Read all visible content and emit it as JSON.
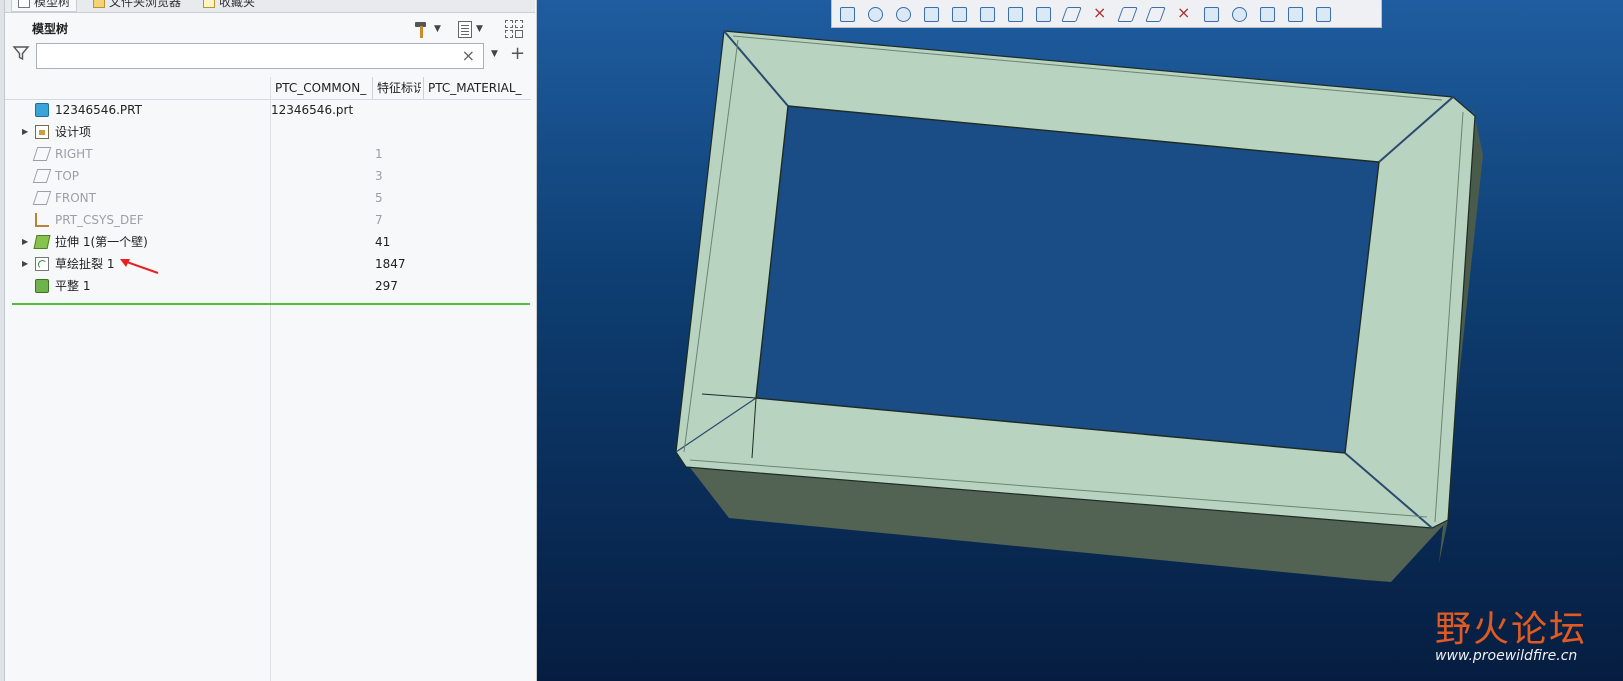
{
  "tabs": [
    {
      "label": "模型树",
      "active": true
    },
    {
      "label": "文件夹浏览器",
      "active": false
    },
    {
      "label": "收藏夹",
      "active": false
    }
  ],
  "panel_title": "模型树",
  "search": {
    "value": "",
    "clear_label": "×"
  },
  "columns": [
    "PTC_COMMON_",
    "特征标识",
    "PTC_MATERIAL_"
  ],
  "tree": [
    {
      "name": "12346546.PRT",
      "common": "12346546.prt",
      "id": "",
      "icon": "part-icon",
      "expandable": false,
      "faded": false
    },
    {
      "name": "设计项",
      "common": "",
      "id": "",
      "icon": "design-items-icon",
      "expandable": true,
      "faded": false
    },
    {
      "name": "RIGHT",
      "common": "",
      "id": "1",
      "icon": "datum-plane-icon",
      "expandable": false,
      "faded": true
    },
    {
      "name": "TOP",
      "common": "",
      "id": "3",
      "icon": "datum-plane-icon",
      "expandable": false,
      "faded": true
    },
    {
      "name": "FRONT",
      "common": "",
      "id": "5",
      "icon": "datum-plane-icon",
      "expandable": false,
      "faded": true
    },
    {
      "name": "PRT_CSYS_DEF",
      "common": "",
      "id": "7",
      "icon": "csys-icon",
      "expandable": false,
      "faded": true
    },
    {
      "name": "拉伸 1(第一个壁)",
      "common": "",
      "id": "41",
      "icon": "extrude-icon",
      "expandable": true,
      "faded": false
    },
    {
      "name": "草绘扯裂 1",
      "common": "",
      "id": "1847",
      "icon": "sketched-rip-icon",
      "expandable": true,
      "faded": false
    },
    {
      "name": "平整 1",
      "common": "",
      "id": "297",
      "icon": "flat-wall-icon",
      "expandable": false,
      "faded": false
    }
  ],
  "watermark": {
    "text_cn": "野火论坛",
    "url": "www.proewildfire.cn"
  },
  "colors": {
    "viewport_top": "#1f5da0",
    "viewport_bottom": "#061d40",
    "model_face": "#b8d3c0",
    "model_side": "#526253",
    "insert_line": "#4fbf3f",
    "annotation_arrow": "#e8201f"
  }
}
